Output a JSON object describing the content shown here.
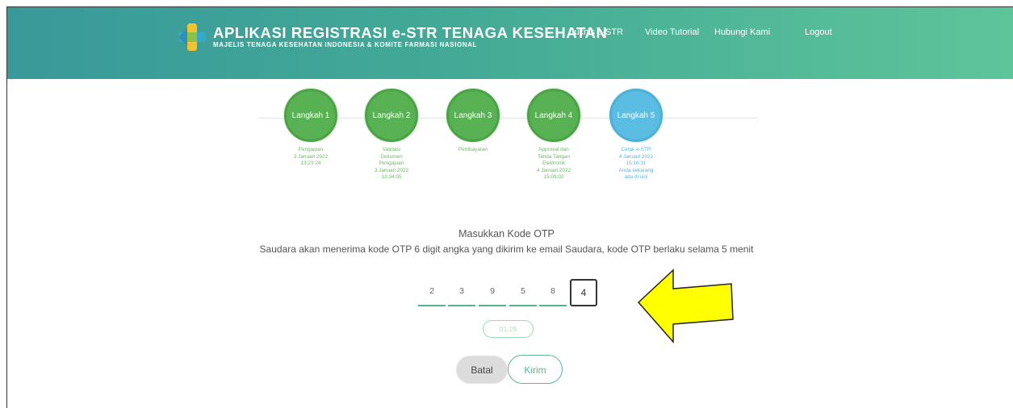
{
  "header": {
    "title": "APLIKASI REGISTRASI e-STR TENAGA KESEHATAN",
    "subtitle": "MAJELIS TENAGA KESEHATAN INDONESIA & KOMITE FARMASI NASIONAL",
    "nav": [
      "Juknis e-STR",
      "Video Tutorial",
      "Hubungi Kami",
      "Logout"
    ],
    "colors": {
      "gradient_start": "#39999a",
      "gradient_end": "#5ec49a"
    }
  },
  "steps": [
    {
      "label": "Langkah 1",
      "desc": "Pengajuan\n3 Januari 2022\n13:23:24",
      "state": "done"
    },
    {
      "label": "Langkah 2",
      "desc": "Validasi\nDokumen\nPengajuan\n3 Januari 2022\n13:34:05",
      "state": "done"
    },
    {
      "label": "Langkah 3",
      "desc": "Pembayaran",
      "state": "done"
    },
    {
      "label": "Langkah 4",
      "desc": "Approval dan\nTanda Tangan\nElektronik\n4 Januari 2022\n15:09:02",
      "state": "done"
    },
    {
      "label": "Langkah 5",
      "desc": "Cetak e-STR\n4 Januari 2022\n15:16:31\nAnda sekarang\nada di sini",
      "state": "current"
    }
  ],
  "otp": {
    "title": "Masukkan Kode OTP",
    "description": "Saudara akan menerima kode OTP 6 digit angka yang dikirim ke email Saudara, kode OTP berlaku selama 5 menit",
    "digits": [
      "2",
      "3",
      "9",
      "5",
      "8",
      "4"
    ],
    "timer": "01:28"
  },
  "buttons": {
    "cancel": "Batal",
    "submit": "Kirim"
  },
  "annotation": {
    "type": "arrow-pointing-left",
    "color": "#ffff00"
  }
}
